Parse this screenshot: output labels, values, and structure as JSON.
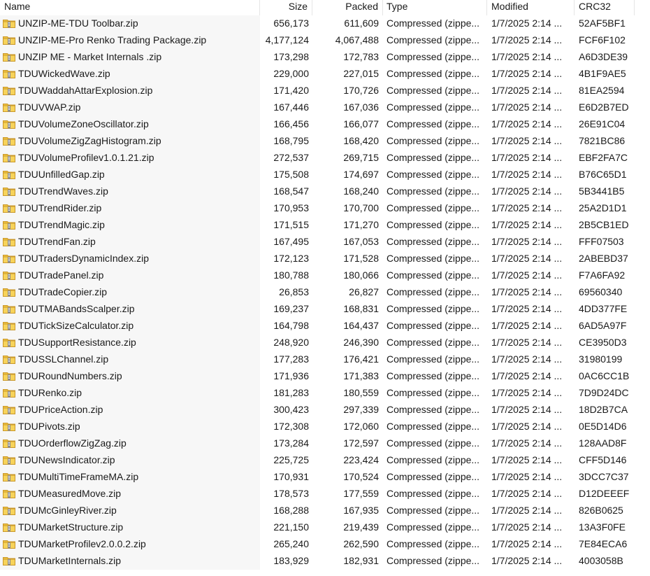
{
  "columns": {
    "name": "Name",
    "size": "Size",
    "packed": "Packed",
    "type": "Type",
    "modified": "Modified",
    "crc": "CRC32"
  },
  "files": [
    {
      "name": "UNZIP-ME-TDU Toolbar.zip",
      "size": "656,173",
      "packed": "611,609",
      "type": "Compressed (zippe...",
      "modified": "1/7/2025 2:14 ...",
      "crc": "52AF5BF1"
    },
    {
      "name": "UNZIP-ME-Pro Renko Trading Package.zip",
      "size": "4,177,124",
      "packed": "4,067,488",
      "type": "Compressed (zippe...",
      "modified": "1/7/2025 2:14 ...",
      "crc": "FCF6F102"
    },
    {
      "name": "UNZIP ME - Market Internals .zip",
      "size": "173,298",
      "packed": "172,783",
      "type": "Compressed (zippe...",
      "modified": "1/7/2025 2:14 ...",
      "crc": "A6D3DE39"
    },
    {
      "name": "TDUWickedWave.zip",
      "size": "229,000",
      "packed": "227,015",
      "type": "Compressed (zippe...",
      "modified": "1/7/2025 2:14 ...",
      "crc": "4B1F9AE5"
    },
    {
      "name": "TDUWaddahAttarExplosion.zip",
      "size": "171,420",
      "packed": "170,726",
      "type": "Compressed (zippe...",
      "modified": "1/7/2025 2:14 ...",
      "crc": "81EA2594"
    },
    {
      "name": "TDUVWAP.zip",
      "size": "167,446",
      "packed": "167,036",
      "type": "Compressed (zippe...",
      "modified": "1/7/2025 2:14 ...",
      "crc": "E6D2B7ED"
    },
    {
      "name": "TDUVolumeZoneOscillator.zip",
      "size": "166,456",
      "packed": "166,077",
      "type": "Compressed (zippe...",
      "modified": "1/7/2025 2:14 ...",
      "crc": "26E91C04"
    },
    {
      "name": "TDUVolumeZigZagHistogram.zip",
      "size": "168,795",
      "packed": "168,420",
      "type": "Compressed (zippe...",
      "modified": "1/7/2025 2:14 ...",
      "crc": "7821BC86"
    },
    {
      "name": "TDUVolumeProfilev1.0.1.21.zip",
      "size": "272,537",
      "packed": "269,715",
      "type": "Compressed (zippe...",
      "modified": "1/7/2025 2:14 ...",
      "crc": "EBF2FA7C"
    },
    {
      "name": "TDUUnfilledGap.zip",
      "size": "175,508",
      "packed": "174,697",
      "type": "Compressed (zippe...",
      "modified": "1/7/2025 2:14 ...",
      "crc": "B76C65D1"
    },
    {
      "name": "TDUTrendWaves.zip",
      "size": "168,547",
      "packed": "168,240",
      "type": "Compressed (zippe...",
      "modified": "1/7/2025 2:14 ...",
      "crc": "5B3441B5"
    },
    {
      "name": "TDUTrendRider.zip",
      "size": "170,953",
      "packed": "170,700",
      "type": "Compressed (zippe...",
      "modified": "1/7/2025 2:14 ...",
      "crc": "25A2D1D1"
    },
    {
      "name": "TDUTrendMagic.zip",
      "size": "171,515",
      "packed": "171,270",
      "type": "Compressed (zippe...",
      "modified": "1/7/2025 2:14 ...",
      "crc": "2B5CB1ED"
    },
    {
      "name": "TDUTrendFan.zip",
      "size": "167,495",
      "packed": "167,053",
      "type": "Compressed (zippe...",
      "modified": "1/7/2025 2:14 ...",
      "crc": "FFF07503"
    },
    {
      "name": "TDUTradersDynamicIndex.zip",
      "size": "172,123",
      "packed": "171,528",
      "type": "Compressed (zippe...",
      "modified": "1/7/2025 2:14 ...",
      "crc": "2ABEBD37"
    },
    {
      "name": "TDUTradePanel.zip",
      "size": "180,788",
      "packed": "180,066",
      "type": "Compressed (zippe...",
      "modified": "1/7/2025 2:14 ...",
      "crc": "F7A6FA92"
    },
    {
      "name": "TDUTradeCopier.zip",
      "size": "26,853",
      "packed": "26,827",
      "type": "Compressed (zippe...",
      "modified": "1/7/2025 2:14 ...",
      "crc": "69560340"
    },
    {
      "name": "TDUTMABandsScalper.zip",
      "size": "169,237",
      "packed": "168,831",
      "type": "Compressed (zippe...",
      "modified": "1/7/2025 2:14 ...",
      "crc": "4DD377FE"
    },
    {
      "name": "TDUTickSizeCalculator.zip",
      "size": "164,798",
      "packed": "164,437",
      "type": "Compressed (zippe...",
      "modified": "1/7/2025 2:14 ...",
      "crc": "6AD5A97F"
    },
    {
      "name": "TDUSupportResistance.zip",
      "size": "248,920",
      "packed": "246,390",
      "type": "Compressed (zippe...",
      "modified": "1/7/2025 2:14 ...",
      "crc": "CE3950D3"
    },
    {
      "name": "TDUSSLChannel.zip",
      "size": "177,283",
      "packed": "176,421",
      "type": "Compressed (zippe...",
      "modified": "1/7/2025 2:14 ...",
      "crc": "31980199"
    },
    {
      "name": "TDURoundNumbers.zip",
      "size": "171,936",
      "packed": "171,383",
      "type": "Compressed (zippe...",
      "modified": "1/7/2025 2:14 ...",
      "crc": "0AC6CC1B"
    },
    {
      "name": "TDURenko.zip",
      "size": "181,283",
      "packed": "180,559",
      "type": "Compressed (zippe...",
      "modified": "1/7/2025 2:14 ...",
      "crc": "7D9D24DC"
    },
    {
      "name": "TDUPriceAction.zip",
      "size": "300,423",
      "packed": "297,339",
      "type": "Compressed (zippe...",
      "modified": "1/7/2025 2:14 ...",
      "crc": "18D2B7CA"
    },
    {
      "name": "TDUPivots.zip",
      "size": "172,308",
      "packed": "172,060",
      "type": "Compressed (zippe...",
      "modified": "1/7/2025 2:14 ...",
      "crc": "0E5D14D6"
    },
    {
      "name": "TDUOrderflowZigZag.zip",
      "size": "173,284",
      "packed": "172,597",
      "type": "Compressed (zippe...",
      "modified": "1/7/2025 2:14 ...",
      "crc": "128AAD8F"
    },
    {
      "name": "TDUNewsIndicator.zip",
      "size": "225,725",
      "packed": "223,424",
      "type": "Compressed (zippe...",
      "modified": "1/7/2025 2:14 ...",
      "crc": "CFF5D146"
    },
    {
      "name": "TDUMultiTimeFrameMA.zip",
      "size": "170,931",
      "packed": "170,524",
      "type": "Compressed (zippe...",
      "modified": "1/7/2025 2:14 ...",
      "crc": "3DCC7C37"
    },
    {
      "name": "TDUMeasuredMove.zip",
      "size": "178,573",
      "packed": "177,559",
      "type": "Compressed (zippe...",
      "modified": "1/7/2025 2:14 ...",
      "crc": "D12DEEEF"
    },
    {
      "name": "TDUMcGinleyRiver.zip",
      "size": "168,288",
      "packed": "167,935",
      "type": "Compressed (zippe...",
      "modified": "1/7/2025 2:14 ...",
      "crc": "826B0625"
    },
    {
      "name": "TDUMarketStructure.zip",
      "size": "221,150",
      "packed": "219,439",
      "type": "Compressed (zippe...",
      "modified": "1/7/2025 2:14 ...",
      "crc": "13A3F0FE"
    },
    {
      "name": "TDUMarketProfilev2.0.0.2.zip",
      "size": "265,240",
      "packed": "262,590",
      "type": "Compressed (zippe...",
      "modified": "1/7/2025 2:14 ...",
      "crc": "7E84ECA6"
    },
    {
      "name": "TDUMarketInternals.zip",
      "size": "183,929",
      "packed": "182,931",
      "type": "Compressed (zippe...",
      "modified": "1/7/2025 2:14 ...",
      "crc": "4003058B"
    }
  ]
}
